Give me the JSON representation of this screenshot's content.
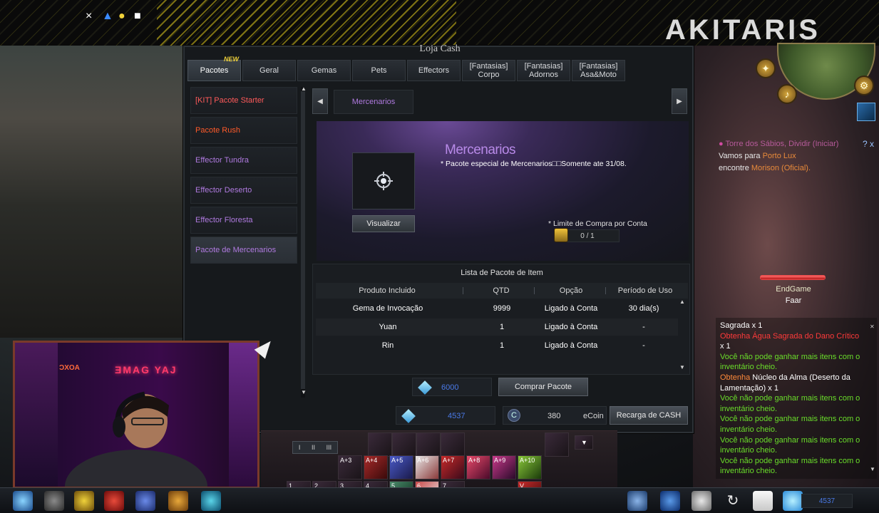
{
  "stream_overlay": {
    "banner_logo": "AKITARIS",
    "ps_icons": [
      "×",
      "▲",
      "●",
      "■"
    ]
  },
  "shop": {
    "title": "Loja Cash",
    "tabs": [
      {
        "label": "Pacotes",
        "active": true,
        "badge": "NEW"
      },
      {
        "label": "Geral"
      },
      {
        "label": "Gemas"
      },
      {
        "label": "Pets"
      },
      {
        "label": "Effectors"
      },
      {
        "label": "[Fantasias]\nCorpo"
      },
      {
        "label": "[Fantasias]\nAdornos"
      },
      {
        "label": "[Fantasias]\nAsa&Moto"
      }
    ],
    "packages": [
      {
        "label": "[KIT] Pacote Starter",
        "color": "#ff5a5a"
      },
      {
        "label": "Pacote Rush",
        "color": "#ff5a2a"
      },
      {
        "label": "Effector Tundra",
        "color": "#b07ae0"
      },
      {
        "label": "Effector Deserto",
        "color": "#b07ae0"
      },
      {
        "label": "Effector Floresta",
        "color": "#b07ae0"
      },
      {
        "label": "Pacote de Mercenarios",
        "color": "#b07ae0",
        "selected": true
      }
    ],
    "subnav": {
      "left_arrow": "◀",
      "right_arrow": "▶",
      "active_subtab": "Mercenarios"
    },
    "detail": {
      "title": "Mercenarios",
      "description": "* Pacote especial de Mercenarios□□Somente ate 31/08.",
      "view_button": "Visualizar",
      "limit_label": "* Limite de Compra por Conta",
      "limit_value": "0 / 1"
    },
    "item_list": {
      "title": "Lista de Pacote de Item",
      "headers": [
        "Produto Incluido",
        "QTD",
        "Opção",
        "Período de Uso"
      ],
      "rows": [
        [
          "Gema de Invocação",
          "9999",
          "Ligado à Conta",
          "30 dia(s)"
        ],
        [
          "Yuan",
          "1",
          "Ligado à Conta",
          "-"
        ],
        [
          "Rin",
          "1",
          "Ligado à Conta",
          "-"
        ]
      ]
    },
    "price": "6000",
    "buy_button": "Comprar Pacote",
    "wallet": {
      "cash": "4537",
      "ecoin_value": "380",
      "ecoin_label": "eCoin",
      "recharge_button": "Recarga de CASH"
    }
  },
  "quest_tracker": {
    "title": "Torre dos Sábios, Dividir (Iniciar)",
    "close": "? x",
    "line1_prefix": "Vamos para ",
    "line1_highlight": "Porto Lux",
    "line2_prefix": "encontre ",
    "line2_highlight": "Morison (Oficial)."
  },
  "player": {
    "name": "EndGame",
    "title": "Faar"
  },
  "chat": [
    {
      "text": "Sagrada x 1",
      "color": "white"
    },
    {
      "text": "Obtenha Água Sagrada do Dano Crítico",
      "color": "red"
    },
    {
      "text": "x 1",
      "color": "white"
    },
    {
      "text": "Você não pode ganhar mais itens com o inventário cheio.",
      "color": "green"
    },
    {
      "text": "Obtenha",
      "color": "orange",
      "rest": " Núcleo da Alma (Deserto da Lamentação) x 1"
    },
    {
      "text": "Você não pode ganhar mais itens com o inventário cheio.",
      "color": "green"
    },
    {
      "text": "Você não pode ganhar mais itens com o inventário cheio.",
      "color": "green"
    },
    {
      "text": "Você não pode ganhar mais itens com o inventário cheio.",
      "color": "green"
    },
    {
      "text": "Você não pode ganhar mais itens com o inventário cheio.",
      "color": "green"
    }
  ],
  "webcam": {
    "neon_sign": "ƎMAG YAJ",
    "neon_small": "ƆXOA"
  },
  "hotbar": {
    "top_labels": [
      "A+3",
      "A+4",
      "A+5",
      "A+6",
      "A+7",
      "A+8",
      "A+9",
      "A+10"
    ],
    "bottom_labels": [
      "1",
      "2",
      "3",
      "4",
      "5",
      "6",
      "7",
      "V"
    ]
  },
  "bottom_bar": {
    "cash": "4537"
  }
}
